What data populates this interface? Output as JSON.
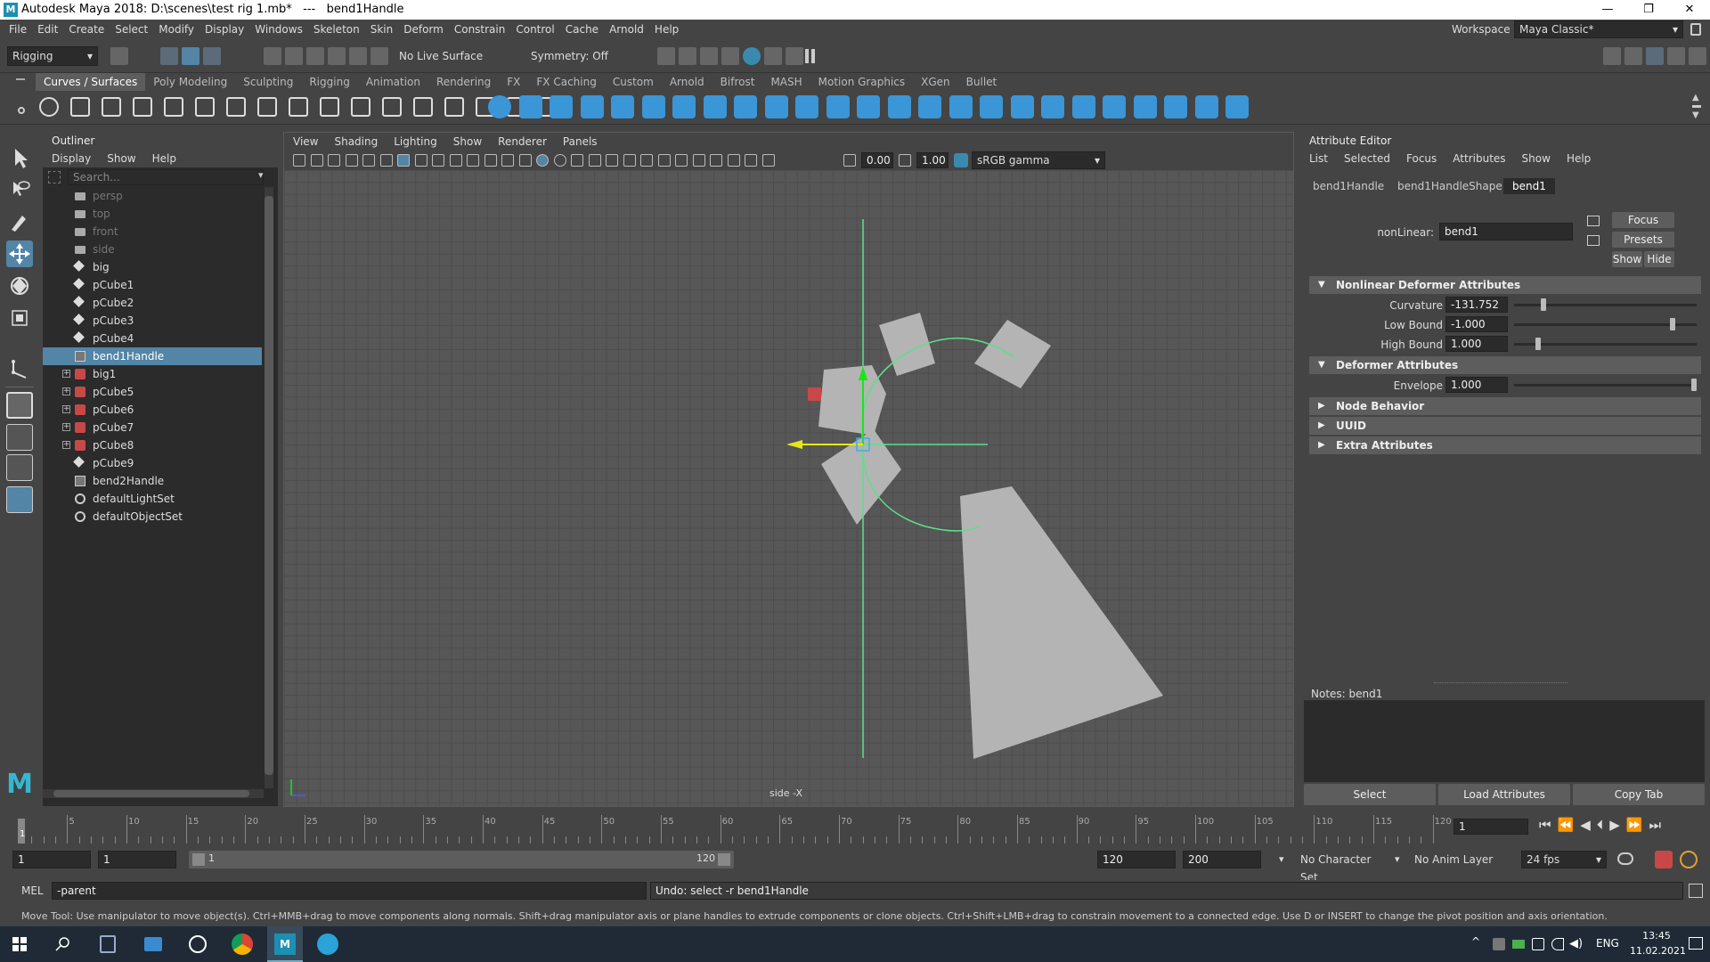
{
  "window": {
    "title": "Autodesk Maya 2018: D:\\scenes\\test rig 1.mb*   ---   bend1Handle",
    "minimize": "—",
    "maximize": "❐",
    "close": "✕"
  },
  "menubar": {
    "items": [
      "File",
      "Edit",
      "Create",
      "Select",
      "Modify",
      "Display",
      "Windows",
      "Skeleton",
      "Skin",
      "Deform",
      "Constrain",
      "Control",
      "Cache",
      "Arnold",
      "Help"
    ],
    "workspace_label": "Workspace :",
    "workspace_value": "Maya Classic*"
  },
  "statusline": {
    "menuset": "Rigging",
    "live_surface": "No Live Surface",
    "symmetry": "Symmetry: Off"
  },
  "shelf": {
    "tabs": [
      "Curves / Surfaces",
      "Poly Modeling",
      "Sculpting",
      "Rigging",
      "Animation",
      "Rendering",
      "FX",
      "FX Caching",
      "Custom",
      "Arnold",
      "Bifrost",
      "MASH",
      "Motion Graphics",
      "XGen",
      "Bullet"
    ],
    "active_tab": "Curves / Surfaces"
  },
  "outliner": {
    "title": "Outliner",
    "menu": [
      "Display",
      "Show",
      "Help"
    ],
    "search_placeholder": "Search...",
    "items": [
      {
        "label": "persp",
        "type": "camera",
        "dim": true,
        "expand": false,
        "selected": false
      },
      {
        "label": "top",
        "type": "camera",
        "dim": true,
        "expand": false,
        "selected": false
      },
      {
        "label": "front",
        "type": "camera",
        "dim": true,
        "expand": false,
        "selected": false
      },
      {
        "label": "side",
        "type": "camera",
        "dim": true,
        "expand": false,
        "selected": false
      },
      {
        "label": "big",
        "type": "mesh",
        "dim": false,
        "expand": false,
        "selected": false
      },
      {
        "label": "pCube1",
        "type": "mesh",
        "dim": false,
        "expand": false,
        "selected": false
      },
      {
        "label": "pCube2",
        "type": "mesh",
        "dim": false,
        "expand": false,
        "selected": false
      },
      {
        "label": "pCube3",
        "type": "mesh",
        "dim": false,
        "expand": false,
        "selected": false
      },
      {
        "label": "pCube4",
        "type": "mesh",
        "dim": false,
        "expand": false,
        "selected": false
      },
      {
        "label": "bend1Handle",
        "type": "deformer",
        "dim": false,
        "expand": false,
        "selected": true
      },
      {
        "label": "big1",
        "type": "deformed",
        "dim": false,
        "expand": true,
        "selected": false
      },
      {
        "label": "pCube5",
        "type": "deformed",
        "dim": false,
        "expand": true,
        "selected": false
      },
      {
        "label": "pCube6",
        "type": "deformed",
        "dim": false,
        "expand": true,
        "selected": false
      },
      {
        "label": "pCube7",
        "type": "deformed",
        "dim": false,
        "expand": true,
        "selected": false
      },
      {
        "label": "pCube8",
        "type": "deformed",
        "dim": false,
        "expand": true,
        "selected": false
      },
      {
        "label": "pCube9",
        "type": "mesh",
        "dim": false,
        "expand": false,
        "selected": false
      },
      {
        "label": "bend2Handle",
        "type": "deformer",
        "dim": false,
        "expand": false,
        "selected": false
      },
      {
        "label": "defaultLightSet",
        "type": "set",
        "dim": false,
        "expand": false,
        "selected": false
      },
      {
        "label": "defaultObjectSet",
        "type": "set",
        "dim": false,
        "expand": false,
        "selected": false
      }
    ]
  },
  "viewport": {
    "menu": [
      "View",
      "Shading",
      "Lighting",
      "Show",
      "Renderer",
      "Panels"
    ],
    "exposure": "0.00",
    "gamma": "1.00",
    "colorspace": "sRGB gamma",
    "camera_label": "side -X"
  },
  "attribute_editor": {
    "title": "Attribute Editor",
    "menu": [
      "List",
      "Selected",
      "Focus",
      "Attributes",
      "Show",
      "Help"
    ],
    "tabs": [
      "bend1Handle",
      "bend1HandleShape",
      "bend1"
    ],
    "active_tab": "bend1",
    "node_label": "nonLinear:",
    "node_value": "bend1",
    "buttons": {
      "focus": "Focus",
      "presets": "Presets",
      "show": "Show",
      "hide": "Hide"
    },
    "sections": {
      "nonlinear": "Nonlinear Deformer Attributes",
      "deformer": "Deformer Attributes",
      "node_behavior": "Node Behavior",
      "uuid": "UUID",
      "extra": "Extra Attributes"
    },
    "attrs": {
      "curvature": {
        "label": "Curvature",
        "value": "-131.752",
        "slider": 0.15
      },
      "low_bound": {
        "label": "Low Bound",
        "value": "-1.000",
        "slider": 0.88
      },
      "high_bound": {
        "label": "High Bound",
        "value": "1.000",
        "slider": 0.12
      },
      "envelope": {
        "label": "Envelope",
        "value": "1.000",
        "slider": 1.0
      }
    },
    "notes_label": "Notes:  bend1",
    "bottom_buttons": {
      "select": "Select",
      "load": "Load Attributes",
      "copy": "Copy Tab"
    }
  },
  "timeline": {
    "ticks": [
      5,
      10,
      15,
      20,
      25,
      30,
      35,
      40,
      45,
      50,
      55,
      60,
      65,
      70,
      75,
      80,
      85,
      90,
      95,
      100,
      105,
      110,
      115,
      120
    ],
    "current_frame_marker": "1",
    "current_frame": "1"
  },
  "range": {
    "start": "1",
    "playback_start": "1",
    "slider_start": "1",
    "slider_end": "120",
    "playback_end": "120",
    "end": "200",
    "character_set": "No Character Set",
    "anim_layer": "No Anim Layer",
    "fps": "24 fps"
  },
  "command_line": {
    "language": "MEL",
    "input": "-parent",
    "result": "Undo: select -r bend1Handle"
  },
  "help_line": "Move Tool: Use manipulator to move object(s). Ctrl+MMB+drag to move components along normals. Shift+drag manipulator axis or plane handles to extrude components or clone objects. Ctrl+Shift+LMB+drag to constrain movement to a connected edge. Use D or INSERT to change the pivot position and axis orientation.",
  "taskbar": {
    "language": "ENG",
    "time": "13:45",
    "date": "11.02.2021"
  },
  "colors": {
    "selection": "#5285a6",
    "panel_dark": "#2b2b2b",
    "panel_mid": "#444444",
    "section": "#5d5d5d",
    "manip_green": "#19e619",
    "manip_yellow": "#e6e619",
    "axis_green_line": "#5de08a",
    "mesh_gray": "#b4b4b4"
  }
}
